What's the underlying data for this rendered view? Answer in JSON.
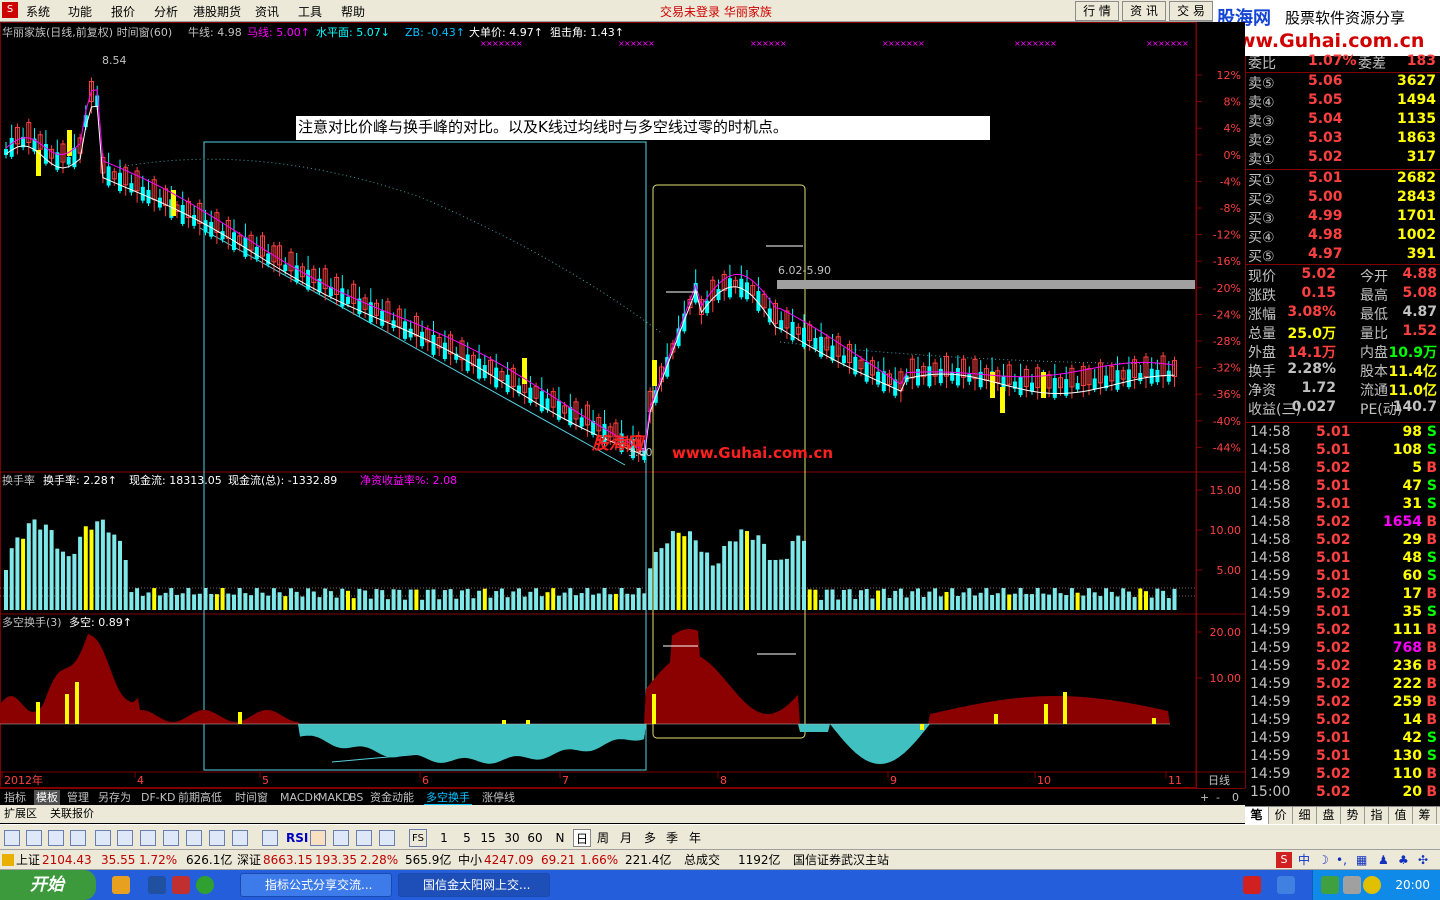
{
  "menubar": {
    "items": [
      "系统",
      "功能",
      "报价",
      "分析",
      "港股期货",
      "资讯",
      "工具",
      "帮助"
    ],
    "center_title": "交易未登录  华丽家族",
    "right_buttons": [
      "行 情",
      "资 讯",
      "交 易"
    ]
  },
  "brand": {
    "line1_a": "股海网",
    "line1_b": "股票软件资源分享",
    "line2": "Www.Guhai.com.cn"
  },
  "main_chart": {
    "header": {
      "stock": "华丽家族(日线,前复权) 时间窗(60)",
      "niu_label": "牛线: 4.98",
      "ma_label": "马线: 5.00↑",
      "level_label": "水平面: 5.07↓",
      "zb_label": "ZB: -0.43↑",
      "big_label": "大单价: 4.97↑",
      "angle_label": "狙击角: 1.43↑"
    },
    "high_marker": "8.54",
    "low_marker": "6.02-5.90",
    "low_bottom": "3.60",
    "watermark_site": "www.Guhai.com.cn",
    "watermark_cn": "股海网",
    "y_axis": [
      "12%",
      "8%",
      "4%",
      "0%",
      "-4%",
      "-8%",
      "-12%",
      "-16%",
      "-20%",
      "-24%",
      "-28%",
      "-32%",
      "-36%",
      "-40%",
      "-44%"
    ],
    "annotation": "注意对比价峰与换手峰的对比。以及K线过均线时与多空线过零的时机点。",
    "colors": {
      "up": "#ff4040",
      "down": "#00ffff",
      "ma1": "#ffffff",
      "ma2": "#ff00ff",
      "box1": "#54d2e0",
      "box2": "#e0e070",
      "yellow": "#ffff00"
    }
  },
  "turnover_panel": {
    "header": {
      "title": "换手率",
      "rate": "换手率: 2.28↑",
      "cash": "现金流: 18313.05",
      "cash_total": "现金流(总): -1332.89",
      "net": "净资收益率%: 2.08"
    },
    "y_axis": [
      "15.00",
      "10.00",
      "5.00"
    ]
  },
  "bullbear_panel": {
    "header": {
      "title": "多空换手(3)",
      "value": "多空: 0.89↑"
    },
    "y_axis": [
      "20.00",
      "10.00"
    ]
  },
  "x_axis": {
    "labels": [
      "2012年",
      "4",
      "5",
      "6",
      "7",
      "8",
      "9",
      "10",
      "11"
    ],
    "period": "日线"
  },
  "tabs": {
    "items": [
      "指标",
      "模板",
      "管理",
      "另存为",
      "DF-KD",
      "前期高低",
      "时间窗",
      "MACDK",
      "MAKD",
      "BS",
      "资金动能",
      "多空换手",
      "涨停线"
    ],
    "active": "多空换手",
    "selected": "模板",
    "right_controls": [
      "+",
      "-",
      "0"
    ],
    "row2": [
      "扩展区",
      "关联报价"
    ]
  },
  "quote_panel": {
    "header": [
      {
        "label": "委比",
        "value": "1.07%"
      },
      {
        "label": "委差",
        "value": "183"
      }
    ],
    "sells": [
      {
        "label": "卖⑤",
        "price": "5.06",
        "vol": "3627"
      },
      {
        "label": "卖④",
        "price": "5.05",
        "vol": "1494"
      },
      {
        "label": "卖③",
        "price": "5.04",
        "vol": "1135"
      },
      {
        "label": "卖②",
        "price": "5.03",
        "vol": "1863"
      },
      {
        "label": "卖①",
        "price": "5.02",
        "vol": "317"
      }
    ],
    "buys": [
      {
        "label": "买①",
        "price": "5.01",
        "vol": "2682"
      },
      {
        "label": "买②",
        "price": "5.00",
        "vol": "2843"
      },
      {
        "label": "买③",
        "price": "4.99",
        "vol": "1701"
      },
      {
        "label": "买④",
        "price": "4.98",
        "vol": "1002"
      },
      {
        "label": "买⑤",
        "price": "4.97",
        "vol": "391"
      }
    ],
    "stats": [
      {
        "l1": "现价",
        "v1": "5.02",
        "l2": "今开",
        "v2": "4.88"
      },
      {
        "l1": "涨跌",
        "v1": "0.15",
        "l2": "最高",
        "v2": "5.08"
      },
      {
        "l1": "涨幅",
        "v1": "3.08%",
        "l2": "最低",
        "v2": "4.87"
      },
      {
        "l1": "总量",
        "v1": "25.0万",
        "l2": "量比",
        "v2": "1.52"
      },
      {
        "l1": "外盘",
        "v1": "14.1万",
        "l2": "内盘",
        "v2": "10.9万"
      },
      {
        "l1": "换手",
        "v1": "2.28%",
        "l2": "股本",
        "v2": "11.4亿"
      },
      {
        "l1": "净资",
        "v1": "1.72",
        "l2": "流通",
        "v2": "11.0亿"
      },
      {
        "l1": "收益(三)",
        "v1": "0.027",
        "l2": "PE(动)",
        "v2": "140.7"
      }
    ],
    "ticks": [
      {
        "t": "14:58",
        "p": "5.01",
        "v": "98",
        "s": "S"
      },
      {
        "t": "14:58",
        "p": "5.01",
        "v": "108",
        "s": "S"
      },
      {
        "t": "14:58",
        "p": "5.02",
        "v": "5",
        "s": "B"
      },
      {
        "t": "14:58",
        "p": "5.01",
        "v": "47",
        "s": "S"
      },
      {
        "t": "14:58",
        "p": "5.01",
        "v": "31",
        "s": "S"
      },
      {
        "t": "14:58",
        "p": "5.02",
        "v": "1654",
        "s": "B"
      },
      {
        "t": "14:58",
        "p": "5.02",
        "v": "29",
        "s": "B"
      },
      {
        "t": "14:58",
        "p": "5.01",
        "v": "48",
        "s": "S"
      },
      {
        "t": "14:59",
        "p": "5.01",
        "v": "60",
        "s": "S"
      },
      {
        "t": "14:59",
        "p": "5.02",
        "v": "17",
        "s": "B"
      },
      {
        "t": "14:59",
        "p": "5.01",
        "v": "35",
        "s": "S"
      },
      {
        "t": "14:59",
        "p": "5.02",
        "v": "111",
        "s": "B"
      },
      {
        "t": "14:59",
        "p": "5.02",
        "v": "768",
        "s": "B"
      },
      {
        "t": "14:59",
        "p": "5.02",
        "v": "236",
        "s": "B"
      },
      {
        "t": "14:59",
        "p": "5.02",
        "v": "222",
        "s": "B"
      },
      {
        "t": "14:59",
        "p": "5.02",
        "v": "259",
        "s": "B"
      },
      {
        "t": "14:59",
        "p": "5.02",
        "v": "14",
        "s": "B"
      },
      {
        "t": "14:59",
        "p": "5.01",
        "v": "42",
        "s": "S"
      },
      {
        "t": "14:59",
        "p": "5.01",
        "v": "130",
        "s": "S"
      },
      {
        "t": "14:59",
        "p": "5.02",
        "v": "110",
        "s": "B"
      },
      {
        "t": "15:00",
        "p": "5.02",
        "v": "20",
        "s": "B"
      }
    ],
    "tabs": [
      "笔",
      "价",
      "细",
      "盘",
      "势",
      "指",
      "值",
      "筹"
    ]
  },
  "toolbar": {
    "periods": [
      "1",
      "5",
      "15",
      "30",
      "60",
      "N",
      "日",
      "周",
      "月",
      "多",
      "季",
      "年"
    ],
    "labels": [
      "RSI",
      "FS"
    ]
  },
  "statusbar": {
    "sh_name": "上证",
    "sh_val": "2104.43",
    "sh_chg": "35.55",
    "sh_pct": "1.72%",
    "sh_amt": "626.1亿",
    "sz_name": "深证",
    "sz_val": "8663.15",
    "sz_chg": "193.35",
    "sz_pct": "2.28%",
    "sz_amt": "565.9亿",
    "zx_name": "中小",
    "zx_val": "4247.09",
    "zx_chg": "69.21",
    "zx_pct": "1.66%",
    "zx_amt": "221.4亿",
    "total_label": "总成交",
    "total_amt": "1192亿",
    "station": "国信证券武汉主站"
  },
  "taskbar": {
    "start": "开始",
    "tasks": [
      "指标公式分享交流...",
      "国信金太阳网上交..."
    ],
    "clock": "20:00"
  }
}
